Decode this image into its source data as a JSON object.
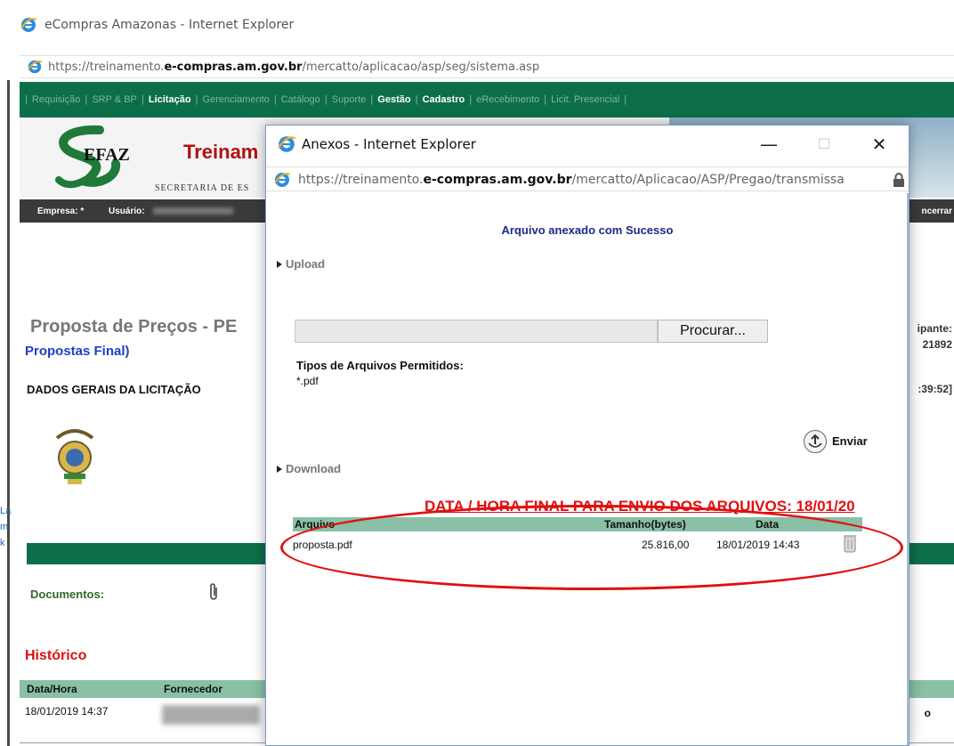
{
  "browser": {
    "title": "eCompras Amazonas - Internet Explorer",
    "url_prefix": "https://treinamento.",
    "url_domain": "e-compras.am.gov.br",
    "url_path": "/mercatto/aplicacao/asp/seg/sistema.asp"
  },
  "nav": {
    "items": [
      "Requisição",
      "SRP & BP",
      "Licitação",
      "Gerenciamento",
      "Catálogo",
      "Suporte",
      "Gestão",
      "Cadastro",
      "eRecebimento",
      "Licit. Presencial"
    ]
  },
  "header": {
    "logo_text": "EFAZ",
    "title_partial": "Treinam",
    "subtitle_partial": "SECRETARIA DE ES"
  },
  "userbar": {
    "empresa_label": "Empresa: *",
    "usuario_label": "Usuário:",
    "encerrar_partial": "ncerrar"
  },
  "page": {
    "title_partial": "Proposta de Preços - PE",
    "subtitle": "Propostas Final)",
    "section": "DADOS GERAIS DA LICITAÇÃO",
    "right_participante": "ipante:",
    "right_number": "21892",
    "right_time": ":39:52]",
    "documentos_label": "Documentos:",
    "historico_label": "Histórico",
    "hist_columns": [
      "Data/Hora",
      "Fornecedor"
    ],
    "hist_row_date": "18/01/2019 14:37",
    "hist_row_right": "o"
  },
  "left_fragments": [
    "La",
    "m",
    "k"
  ],
  "popup": {
    "title": "Anexos - Internet Explorer",
    "minimize": "—",
    "maximize": "☐",
    "close": "✕",
    "url_prefix": "https://treinamento.",
    "url_domain": "e-compras.am.gov.br",
    "url_path": "/mercatto/Aplicacao/ASP/Pregao/transmissa",
    "success_msg": "Arquivo anexado com Sucesso",
    "upload_label": "Upload",
    "browse_label": "Procurar...",
    "allowed_title": "Tipos de Arquivos Permitidos:",
    "allowed_ext": "*.pdf",
    "send_label": "Enviar",
    "download_label": "Download",
    "deadline": "DATA / HORA FINAL PARA ENVIO DOS ARQUIVOS: 18/01/20",
    "columns": {
      "arquivo": "Arquivo",
      "tamanho": "Tamanho(bytes)",
      "data": "Data"
    },
    "file": {
      "name": "proposta.pdf",
      "size": "25.816,00",
      "date": "18/01/2019 14:43"
    }
  }
}
